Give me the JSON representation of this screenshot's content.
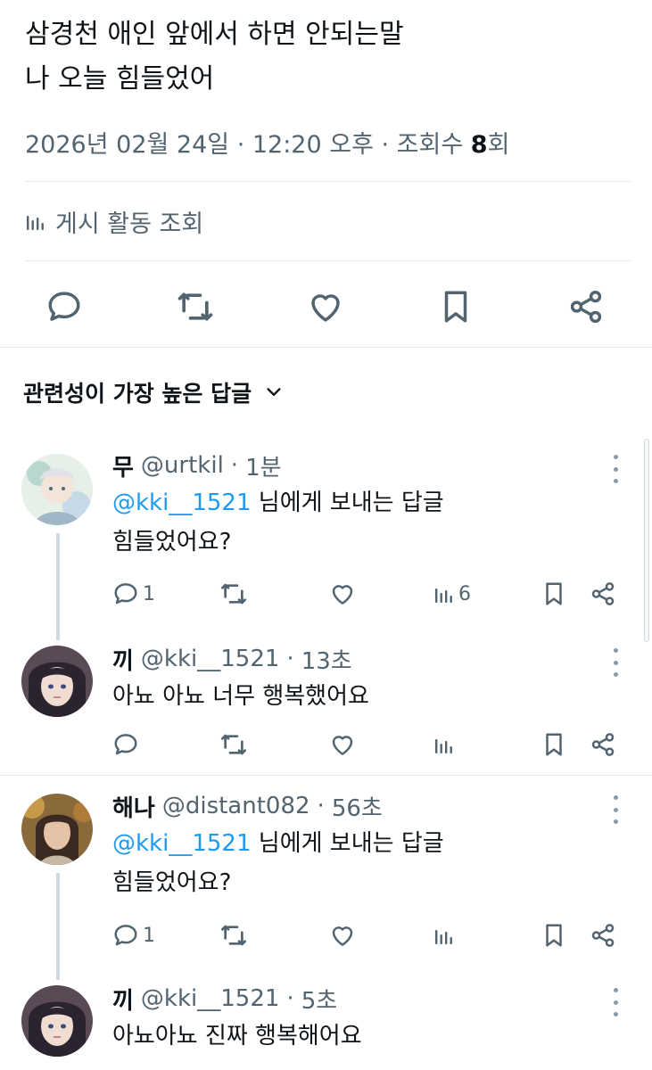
{
  "tweet": {
    "line1": "삼경천 애인 앞에서 하면 안되는말",
    "line2": "나 오늘 힘들었어",
    "meta_date": "2026년 02월 24일 · 12:20 오후 · 조회수 ",
    "meta_views": "8",
    "meta_views_suffix": "회",
    "activity_label": "게시 활동 조회"
  },
  "sort": {
    "label": "관련성이 가장 높은 답글"
  },
  "replies": [
    {
      "name": "무",
      "handle": "@urtkil",
      "time": "1분",
      "replying_mention": "@kki__1521",
      "replying_suffix": " 님에게 보내는 답글",
      "text": "힘들었어요?",
      "reply_count": "1",
      "view_count": "6"
    },
    {
      "name": "끼",
      "handle": "@kki__1521",
      "time": "13초",
      "text": "아뇨 아뇨 너무 행복했어요"
    },
    {
      "name": "해나",
      "handle": "@distant082",
      "time": "56초",
      "replying_mention": "@kki__1521",
      "replying_suffix": " 님에게 보내는 답글",
      "text": "힘들었어요?",
      "reply_count": "1"
    },
    {
      "name": "끼",
      "handle": "@kki__1521",
      "time": "5초",
      "text": "아뇨아뇨 진짜 행복해어요"
    }
  ],
  "icons": {
    "reply": "reply-icon",
    "retweet": "retweet-icon",
    "like": "heart-icon",
    "bookmark": "bookmark-icon",
    "share": "share-icon",
    "views": "bar-chart-icon",
    "more": "more-icon",
    "chevron": "chevron-down-icon"
  },
  "colors": {
    "text": "#0f1419",
    "secondary": "#536471",
    "accent": "#1d9bf0",
    "border": "#e1e8ed"
  }
}
